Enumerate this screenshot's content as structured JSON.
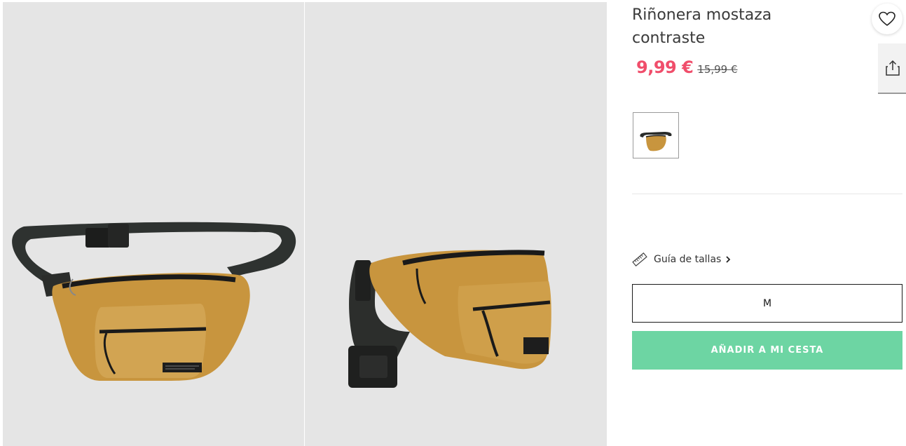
{
  "product": {
    "title": "Riñonera mostaza contraste",
    "price_current": "9,99 €",
    "price_original": "15,99 €",
    "color_swatches": [
      {
        "name": "mostaza",
        "selected": true
      }
    ]
  },
  "size_guide": {
    "label": "Guía de tallas"
  },
  "size_select": {
    "value": "M"
  },
  "cart": {
    "add_label": "AÑADIR A MI CESTA"
  },
  "gallery": {
    "images": [
      {
        "alt": "front-view"
      },
      {
        "alt": "side-view"
      }
    ]
  },
  "icons": {
    "favorite": "heart-icon",
    "share": "share-icon",
    "size_guide": "ruler-icon",
    "chevron": "chevron-right-icon"
  },
  "colors": {
    "price_sale": "#f04e6b",
    "add_button": "#6dd5a3",
    "photo_bg": "#e5e5e5",
    "bag_mustard": "#c8953e"
  }
}
